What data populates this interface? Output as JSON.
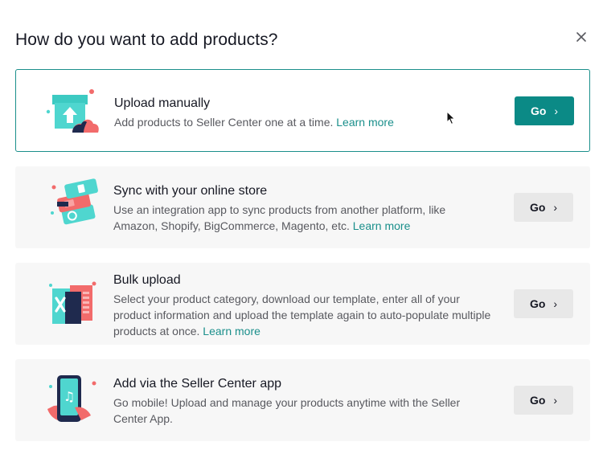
{
  "dialog": {
    "title": "How do you want to add products?"
  },
  "options": [
    {
      "title": "Upload manually",
      "description": "Add products to Seller Center one at a time.",
      "learn_more": "Learn more",
      "button": "Go"
    },
    {
      "title": "Sync with your online store",
      "description": "Use an integration app to sync products from another platform, like Amazon, Shopify, BigCommerce, Magento, etc.",
      "learn_more": "Learn more",
      "button": "Go"
    },
    {
      "title": "Bulk upload",
      "description": "Select your product category, download our template, enter all of your product information and upload the template again to auto-populate multiple products at once.",
      "learn_more": "Learn more",
      "button": "Go"
    },
    {
      "title": "Add via the Seller Center app",
      "description": "Go mobile! Upload and manage your products anytime with the Seller Center App.",
      "button": "Go"
    }
  ],
  "colors": {
    "accent": "#0b8a86",
    "link": "#1a8f8b",
    "card_bg": "#f7f7f7",
    "coral": "#f26b6b",
    "navy": "#1f2a4e",
    "teal_light": "#4fd6cf"
  }
}
